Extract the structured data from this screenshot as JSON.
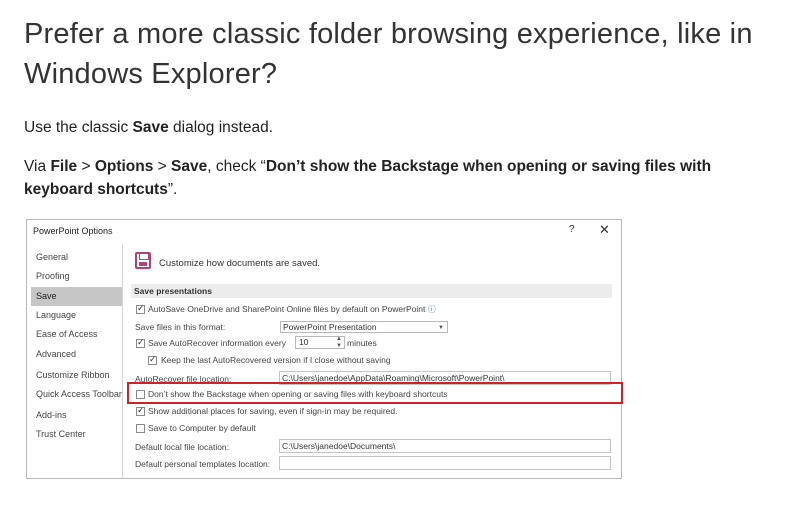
{
  "article": {
    "heading": "Prefer a more classic folder browsing experience, like in Windows Explorer?",
    "p1": {
      "a": "Use the classic ",
      "b": "Save",
      "c": " dialog instead."
    },
    "p2": {
      "a": "Via ",
      "b1": "File",
      "s1": " > ",
      "b2": "Options",
      "s2": " > ",
      "b3": "Save",
      "c": ", check “",
      "b4": "Don’t show the Backstage when opening or saving files with keyboard shortcuts",
      "d": "”."
    }
  },
  "dialog": {
    "title": "PowerPoint Options",
    "help": "?",
    "close": "✕",
    "nav": [
      {
        "label": "General"
      },
      {
        "label": "Proofing"
      },
      {
        "label": "Save",
        "selected": true
      },
      {
        "label": "Language"
      },
      {
        "label": "Ease of Access"
      },
      {
        "label": "Advanced"
      },
      {
        "label": "Customize Ribbon"
      },
      {
        "label": "Quick Access Toolbar"
      },
      {
        "label": "Add-ins"
      },
      {
        "label": "Trust Center"
      }
    ],
    "header_text": "Customize how documents are saved.",
    "section_title": "Save presentations",
    "autosave_label": "AutoSave OneDrive and SharePoint Online files by default on PowerPoint",
    "autosave_checked": true,
    "format_label": "Save files in this format:",
    "format_value": "PowerPoint Presentation",
    "autorecover_label": "Save AutoRecover information every",
    "autorecover_value": "10",
    "minutes_label": "minutes",
    "autorecover_checked": true,
    "keep_label": "Keep the last AutoRecovered version if I close without saving",
    "keep_checked": true,
    "arloc_label": "AutoRecover file location:",
    "arloc_value": "C:\\Users\\janedoe\\AppData\\Roaming\\Microsoft\\PowerPoint\\",
    "backstage_label": "Don’t show the Backstage when opening or saving files with keyboard shortcuts",
    "backstage_checked": false,
    "additional_label": "Show additional places for saving, even if sign-in may be required.",
    "additional_checked": true,
    "computer_label": "Save to Computer by default",
    "computer_checked": false,
    "default_local_label": "Default local file location:",
    "default_local_value": "C:\\Users\\janedoe\\Documents\\",
    "personal_templates_label": "Default personal templates location:",
    "personal_templates_value": ""
  },
  "colors": {
    "highlight": "#d0202a",
    "selected_nav": "#c6c6c6",
    "icon_accent": "#b4407a"
  }
}
